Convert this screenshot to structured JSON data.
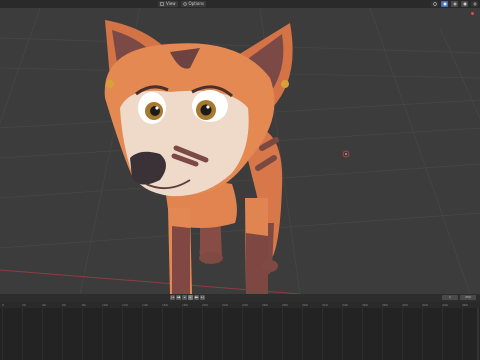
{
  "header": {
    "view_label": "View",
    "options_label": "Options"
  },
  "header_icons": [
    "overlay-icon",
    "shading-solid-icon",
    "shading-material-icon",
    "shading-rendered-icon",
    "gizmo-icon"
  ],
  "viewport": {
    "background_color": "#3c3c3c",
    "grid_color": "#4a4a4a",
    "x_axis_color": "#c4484c",
    "object": "fox-character"
  },
  "timeline": {
    "start_label": "1",
    "end_label": "250",
    "ruler_ticks": [
      "0",
      "20",
      "40",
      "60",
      "80",
      "100",
      "120",
      "140",
      "160",
      "180",
      "200",
      "220",
      "240",
      "260",
      "280",
      "300",
      "320",
      "340",
      "360",
      "380",
      "400",
      "420",
      "440",
      "460"
    ]
  },
  "transport": [
    {
      "icon": "jump-start-icon",
      "symbol": "|◂"
    },
    {
      "icon": "prev-key-icon",
      "symbol": "◂◆"
    },
    {
      "icon": "play-reverse-icon",
      "symbol": "◂"
    },
    {
      "icon": "play-icon",
      "symbol": "▸"
    },
    {
      "icon": "next-key-icon",
      "symbol": "◆▸"
    },
    {
      "icon": "jump-end-icon",
      "symbol": "▸|"
    }
  ]
}
